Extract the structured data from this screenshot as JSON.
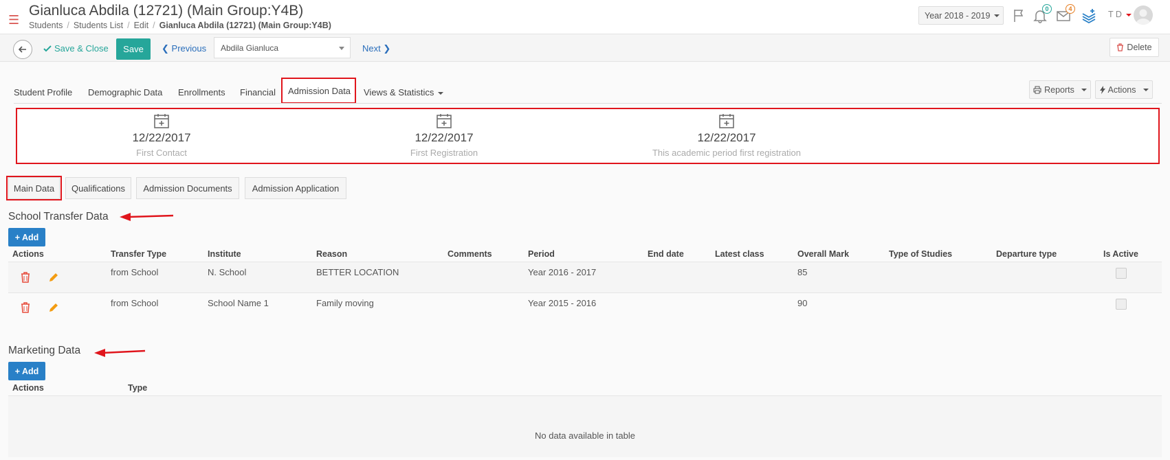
{
  "header": {
    "title": "Gianluca Abdila (12721) (Main Group:Y4B)",
    "breadcrumb": [
      "Students",
      "Students List",
      "Edit",
      "Gianluca Abdila (12721) (Main Group:Y4B)"
    ],
    "year": "Year 2018 - 2019",
    "notifications_count": "0",
    "messages_count": "4",
    "user_initials": "T D"
  },
  "toolbar": {
    "save_close": "Save & Close",
    "save": "Save",
    "previous": "Previous",
    "student_select": "Abdila Gianluca",
    "next": "Next",
    "delete": "Delete"
  },
  "tabs": {
    "items": [
      "Student Profile",
      "Demographic Data",
      "Enrollments",
      "Financial",
      "Admission Data",
      "Views & Statistics"
    ],
    "reports": "Reports",
    "actions": "Actions"
  },
  "stats": [
    {
      "date": "12/22/2017",
      "label": "First Contact"
    },
    {
      "date": "12/22/2017",
      "label": "First Registration"
    },
    {
      "date": "12/22/2017",
      "label": "This academic period first registration"
    }
  ],
  "subtabs": [
    "Main Data",
    "Qualifications",
    "Admission Documents",
    "Admission Application"
  ],
  "school_transfer": {
    "title": "School Transfer Data",
    "add": "Add",
    "columns": [
      "Actions",
      "Transfer Type",
      "Institute",
      "Reason",
      "Comments",
      "Period",
      "End date",
      "Latest class",
      "Overall Mark",
      "Type of Studies",
      "Departure type",
      "Is Active"
    ],
    "rows": [
      {
        "transfer_type": "from School",
        "institute": "N. School",
        "reason": "BETTER LOCATION",
        "period": "Year 2016 - 2017",
        "overall_mark": "85"
      },
      {
        "transfer_type": "from School",
        "institute": "School Name 1",
        "reason": "Family moving",
        "period": "Year 2015 - 2016",
        "overall_mark": "90"
      }
    ]
  },
  "marketing": {
    "title": "Marketing Data",
    "add": "Add",
    "columns": [
      "Actions",
      "Type"
    ],
    "empty_text": "No data available in table"
  },
  "colors": {
    "accent": "#26a69a",
    "primary": "#2980c7",
    "highlight": "#e0151c",
    "link": "#2a6ebb"
  }
}
